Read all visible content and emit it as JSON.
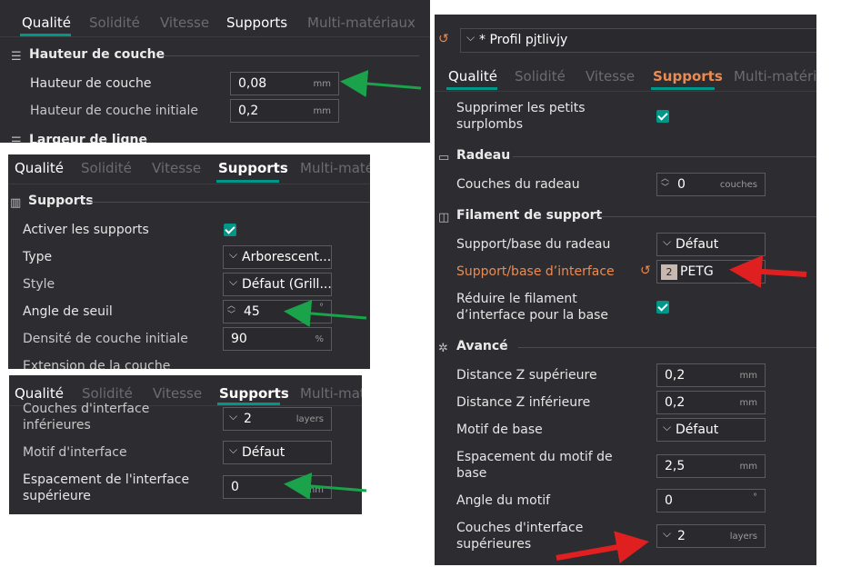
{
  "panel1": {
    "tabs": [
      "Qualité",
      "Solidité",
      "Vitesse",
      "Supports",
      "Multi-matériaux"
    ],
    "section1": "Hauteur de couche",
    "rows": [
      {
        "label": "Hauteur de couche",
        "value": "0,08",
        "unit": "mm"
      },
      {
        "label": "Hauteur de couche initiale",
        "value": "0,2",
        "unit": "mm"
      }
    ],
    "section2": "Largeur de ligne"
  },
  "panel2": {
    "tabs": [
      "Qualité",
      "Solidité",
      "Vitesse",
      "Supports",
      "Multi-maté"
    ],
    "section": "Supports",
    "rows": [
      {
        "label": "Activer les supports"
      },
      {
        "label": "Type",
        "value": "Arborescent..."
      },
      {
        "label": "Style",
        "value": "Défaut (Grill..."
      },
      {
        "label": "Angle de seuil",
        "value": "45",
        "unit": "°"
      },
      {
        "label": "Densité de couche initiale",
        "value": "90",
        "unit": "%"
      },
      {
        "label": "Extension de la couche"
      }
    ]
  },
  "panel3": {
    "tabs": [
      "Qualité",
      "Solidité",
      "Vitesse",
      "Supports",
      "Multi-mat"
    ],
    "rows": [
      {
        "label1": "Couches d'interface",
        "label2": "inférieures",
        "value": "2",
        "unit": "layers"
      },
      {
        "label": "Motif d'interface",
        "value": "Défaut"
      },
      {
        "label1": "Espacement de l'interface",
        "label2": "supérieure",
        "value": "0",
        "unit": "mm"
      }
    ]
  },
  "panel4": {
    "profile": "* Profil pjtlivjy",
    "tabs": [
      "Qualité",
      "Solidité",
      "Vitesse",
      "Supports",
      "Multi-matéria"
    ],
    "top": {
      "label1": "Supprimer les petits",
      "label2": "surplombs"
    },
    "sec_raft": "Radeau",
    "raft_layers": {
      "label": "Couches du radeau",
      "value": "0",
      "unit": "couches"
    },
    "sec_filament": "Filament de support",
    "raft_base": {
      "label": "Support/base du radeau",
      "value": "Défaut"
    },
    "interface_base": {
      "label": "Support/base d’interface",
      "badge": "2",
      "value": "PETG"
    },
    "reduce": {
      "label1": "Réduire le filament",
      "label2": "d’interface pour la base"
    },
    "sec_adv": "Avancé",
    "z_top": {
      "label": "Distance Z supérieure",
      "value": "0,2",
      "unit": "mm"
    },
    "z_bottom": {
      "label": "Distance Z inférieure",
      "value": "0,2",
      "unit": "mm"
    },
    "base_pattern": {
      "label": "Motif de base",
      "value": "Défaut"
    },
    "base_spacing": {
      "label1": "Espacement du motif de",
      "label2": "base",
      "value": "2,5",
      "unit": "mm"
    },
    "pattern_angle": {
      "label": "Angle du motif",
      "value": "0",
      "unit": "°"
    },
    "top_interface": {
      "label1": "Couches d'interface",
      "label2": "supérieures",
      "value": "2",
      "unit": "layers"
    }
  },
  "colors": {
    "accent_teal": "#009688",
    "accent_orange": "#ec8a52",
    "arrow_green": "#1aa34a",
    "arrow_red": "#e02020"
  }
}
